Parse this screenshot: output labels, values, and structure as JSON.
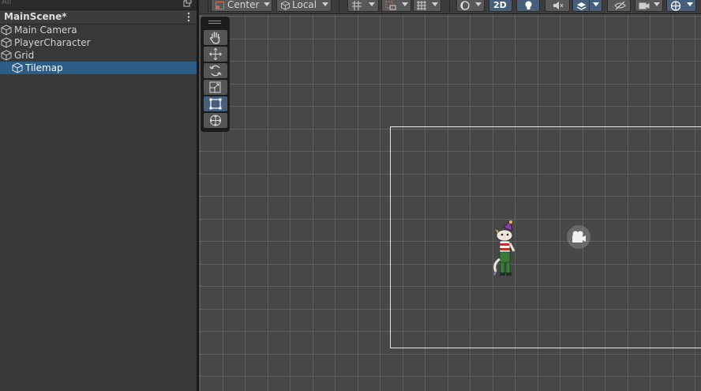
{
  "hierarchy": {
    "search_placeholder": "All",
    "scene_name": "MainScene*",
    "items": [
      {
        "label": "Main Camera"
      },
      {
        "label": "PlayerCharacter"
      },
      {
        "label": "Grid"
      },
      {
        "label": "Tilemap",
        "selected": true
      }
    ]
  },
  "toolbar": {
    "pivot_label": "Center",
    "space_label": "Local",
    "mode_2d_label": "2D"
  },
  "tools": [
    {
      "name": "hand-tool"
    },
    {
      "name": "move-tool"
    },
    {
      "name": "rotate-tool"
    },
    {
      "name": "scale-tool"
    },
    {
      "name": "rect-tool",
      "active": true
    },
    {
      "name": "transform-tool"
    }
  ],
  "colors": {
    "selection": "#2c5d87",
    "scene_bg": "#474747",
    "active_button": "#46607c"
  }
}
